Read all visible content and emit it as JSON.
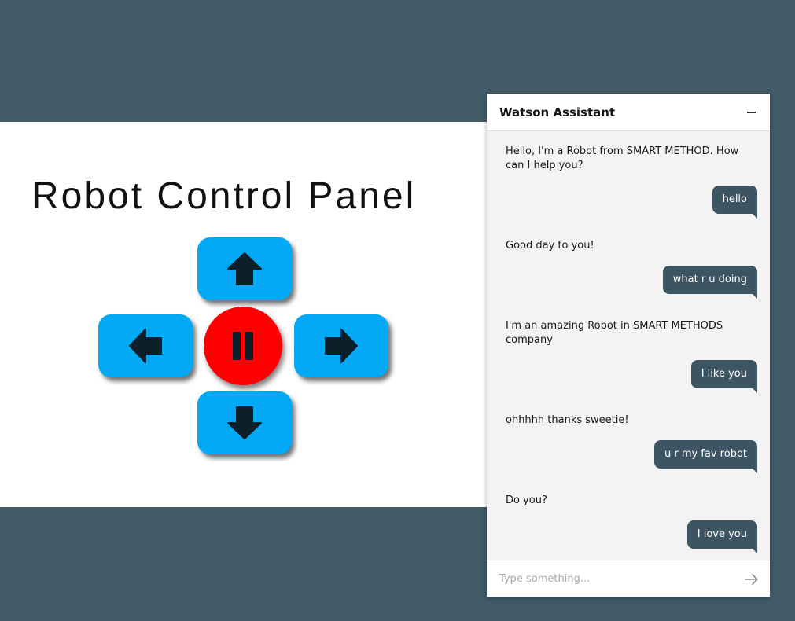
{
  "panel": {
    "title": "Robot Control Panel",
    "controls": {
      "up_icon": "arrow-up-icon",
      "left_icon": "arrow-left-icon",
      "stop_icon": "pause-icon",
      "right_icon": "arrow-right-icon",
      "down_icon": "arrow-down-icon"
    },
    "colors": {
      "direction": "#03a9f4",
      "stop": "#ff0000",
      "icon": "#0d1f2b"
    }
  },
  "chat": {
    "title": "Watson Assistant",
    "minimize_icon": "minimize-icon",
    "messages": [
      {
        "from": "bot",
        "text": "Hello, I'm a Robot from SMART METHOD. How can I help you?"
      },
      {
        "from": "user",
        "text": "hello"
      },
      {
        "from": "bot",
        "text": "Good day to you!"
      },
      {
        "from": "user",
        "text": "what r u doing"
      },
      {
        "from": "bot",
        "text": "I'm an amazing Robot in SMART METHODS company"
      },
      {
        "from": "user",
        "text": "I like you"
      },
      {
        "from": "bot",
        "text": "ohhhhh thanks sweetie!"
      },
      {
        "from": "user",
        "text": "u r my fav robot"
      },
      {
        "from": "bot",
        "text": "Do you?"
      },
      {
        "from": "user",
        "text": "I love you"
      }
    ],
    "input": {
      "placeholder": "Type something...",
      "value": ""
    },
    "send_icon": "send-arrow-icon",
    "colors": {
      "user_bubble": "#3d5563",
      "background": "#f3f3f3"
    }
  },
  "page": {
    "background": "#425b67"
  }
}
